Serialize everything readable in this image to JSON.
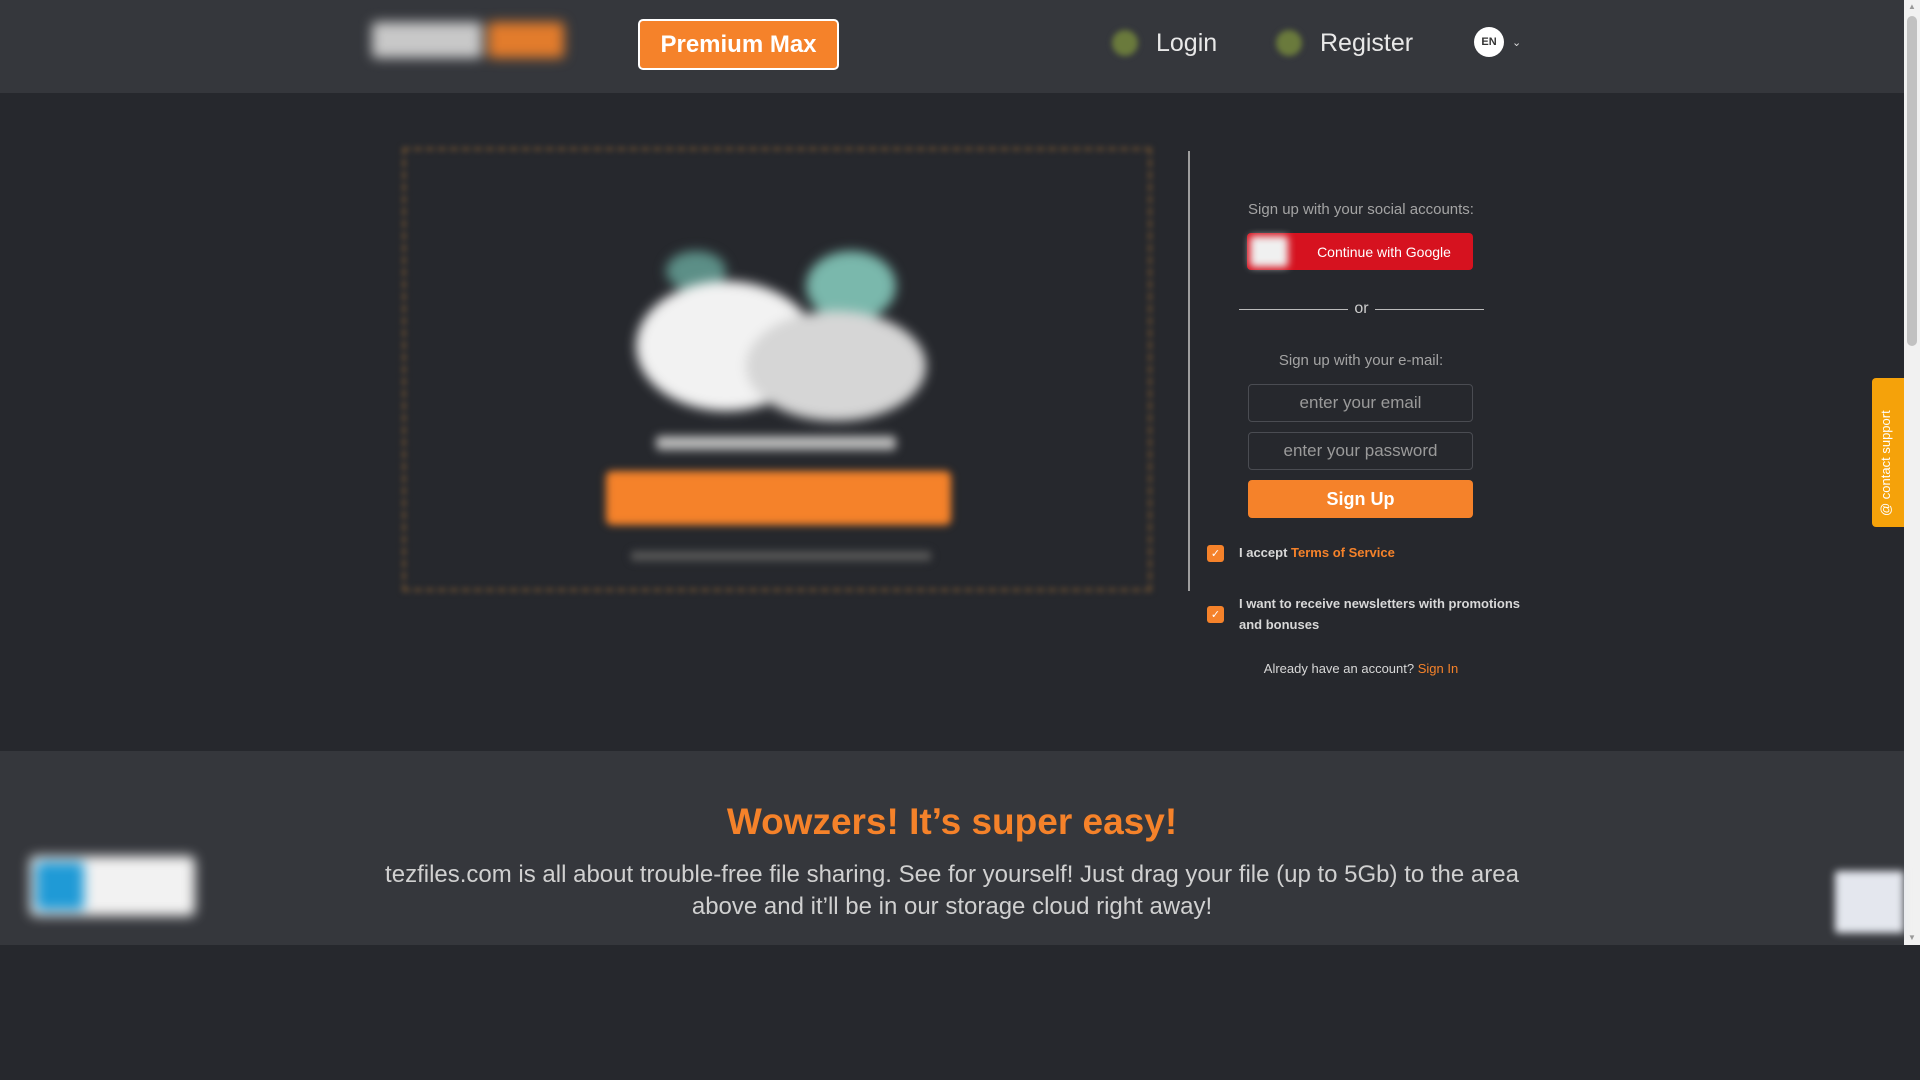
{
  "header": {
    "premium_label": "Premium Max",
    "login_label": "Login",
    "register_label": "Register",
    "language": "EN"
  },
  "signup": {
    "social_heading": "Sign up with your social accounts:",
    "google_label": "Continue with Google",
    "or_text": "or",
    "email_heading": "Sign up with your e-mail:",
    "email_placeholder": "enter your email",
    "password_placeholder": "enter your password",
    "signup_label": "Sign Up",
    "tos_prefix": "I accept",
    "tos_link": "Terms of Service",
    "newsletter_text": "I want to receive newsletters with promotions and bonuses",
    "already_text": "Already have an account?",
    "signin_link": "Sign In"
  },
  "contact_support": "@ contact support",
  "footer": {
    "title": "Wowzers! It’s super easy!",
    "description": "tezfiles.com is all about trouble-free file sharing. See for yourself! Just drag your file (up to 5Gb) to the area above and it’ll be in our storage cloud right away!"
  },
  "colors": {
    "accent": "#f5822a",
    "background": "#26282d",
    "header_bg": "#35373c",
    "google_red": "#d6121f",
    "support_tab": "#f5a20a"
  },
  "icons": {
    "login": "user-icon",
    "register": "user-plus-icon",
    "language_dropdown": "chevron-down-icon",
    "checkbox": "check-icon"
  }
}
